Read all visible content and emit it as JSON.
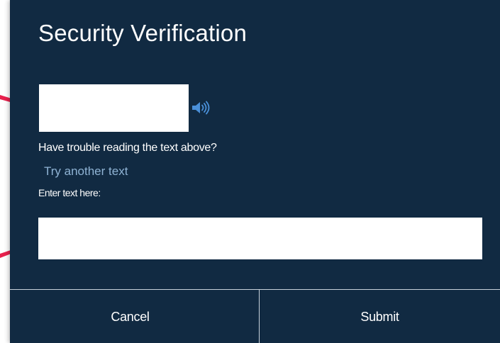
{
  "dialog": {
    "title": "Security Verification",
    "audio_icon": "speaker-icon",
    "trouble_text": "Have trouble reading the text above?",
    "try_another_link": "Try another text",
    "input_label": "Enter text here:",
    "input_value": "",
    "input_placeholder": ""
  },
  "footer": {
    "cancel_label": "Cancel",
    "submit_label": "Submit"
  },
  "colors": {
    "dialog_background": "#112a42",
    "link": "#8fb3d4",
    "audio_icon": "#4a90d9",
    "annotation_arrow": "#e8204d",
    "divider": "#c9d2db"
  }
}
